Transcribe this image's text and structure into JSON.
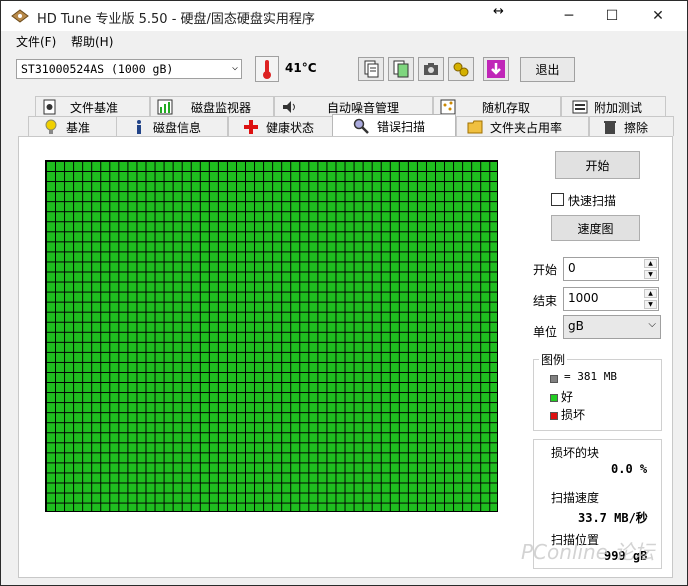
{
  "window": {
    "title": "HD Tune 专业版 5.50 - 硬盘/固态硬盘实用程序",
    "minimize": "─",
    "maximize": "☐",
    "close": "✕",
    "resize_glyph": "↔"
  },
  "menu": [
    "文件(F)",
    "帮助(H)"
  ],
  "toolbar": {
    "drive": "ST31000524AS (1000 gB)",
    "temperature": "41°C",
    "exit_label": "退出",
    "icons": [
      "copy-text-icon",
      "copy-screen-icon",
      "camera-icon",
      "options-icon",
      "save-icon"
    ]
  },
  "tabs_top": [
    {
      "label": "文件基准",
      "icon": "file-benchmark-icon"
    },
    {
      "label": "磁盘监视器",
      "icon": "disk-monitor-icon"
    },
    {
      "label": "自动噪音管理",
      "icon": "speaker-icon"
    },
    {
      "label": "随机存取",
      "icon": "random-access-icon"
    },
    {
      "label": "附加测试",
      "icon": "extra-tests-icon"
    }
  ],
  "tabs_bottom": [
    {
      "label": "基准",
      "icon": "lightbulb-icon"
    },
    {
      "label": "磁盘信息",
      "icon": "info-icon"
    },
    {
      "label": "健康状态",
      "icon": "health-cross-icon"
    },
    {
      "label": "错误扫描",
      "icon": "magnifier-icon",
      "active": true
    },
    {
      "label": "文件夹占用率",
      "icon": "folder-icon"
    },
    {
      "label": "擦除",
      "icon": "trash-icon"
    }
  ],
  "scan": {
    "start_button": "开始",
    "quick_scan_label": "快速扫描",
    "quick_scan_checked": false,
    "speed_map_button": "速度图",
    "start_label": "开始",
    "start_value": "0",
    "end_label": "结束",
    "end_value": "1000",
    "unit_label": "单位",
    "unit_value": "gB",
    "block_status": "good",
    "block_color": "#22bb22"
  },
  "legend": {
    "title": "图例",
    "block_size": "= 381 MB",
    "good": "好",
    "bad": "损坏",
    "good_color": "#22cc22",
    "bad_color": "#dd1111",
    "block_color": "#808080"
  },
  "stats": {
    "damaged_label": "损坏的块",
    "damaged_value": "0.0 %",
    "speed_label": "扫描速度",
    "speed_value": "33.7 MB/秒",
    "position_label": "扫描位置",
    "position_value": "999 gB"
  },
  "watermark": "PConline 论坛"
}
